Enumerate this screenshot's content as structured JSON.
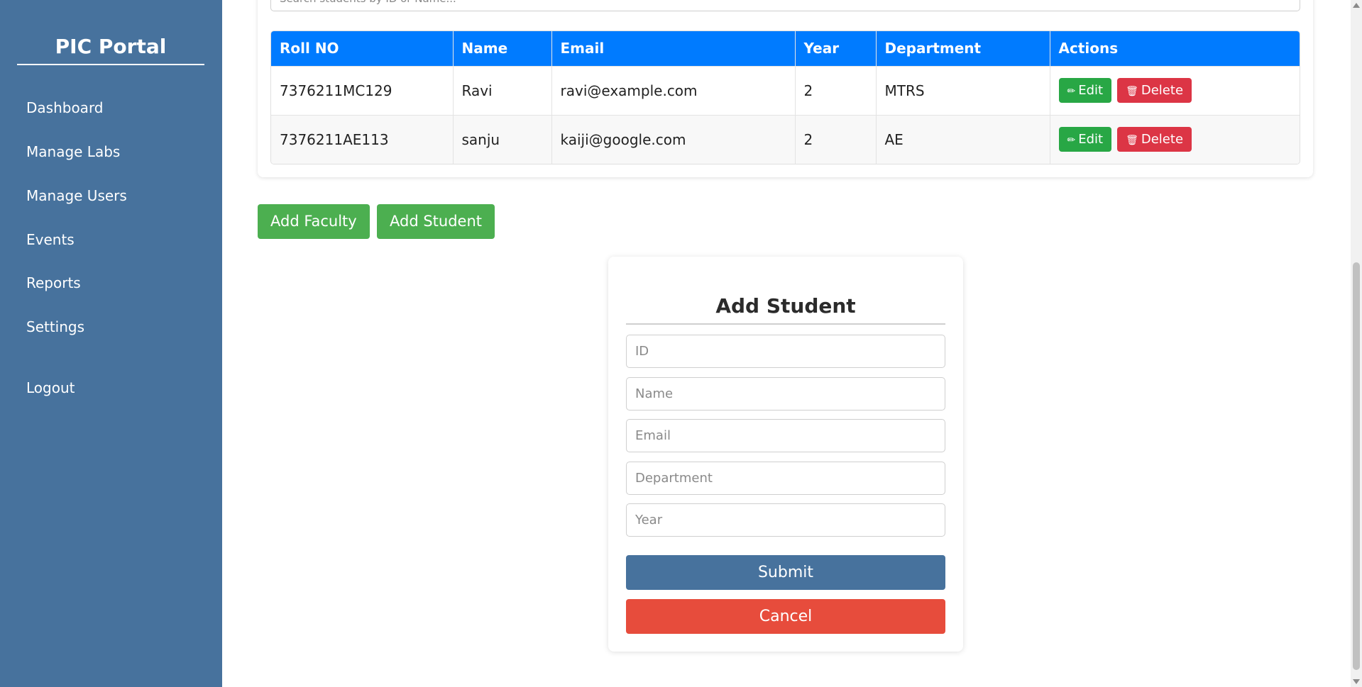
{
  "sidebar": {
    "brand": "PIC Portal",
    "items": [
      {
        "label": "Dashboard"
      },
      {
        "label": "Manage Labs"
      },
      {
        "label": "Manage Users"
      },
      {
        "label": "Events"
      },
      {
        "label": "Reports"
      },
      {
        "label": "Settings"
      },
      {
        "label": "Logout"
      }
    ]
  },
  "search": {
    "placeholder": "Search students by ID or Name..."
  },
  "table": {
    "headers": [
      "Roll NO",
      "Name",
      "Email",
      "Year",
      "Department",
      "Actions"
    ],
    "rows": [
      {
        "roll": "7376211MC129",
        "name": "Ravi",
        "email": "ravi@example.com",
        "year": "2",
        "department": "MTRS"
      },
      {
        "roll": "7376211AE113",
        "name": "sanju",
        "email": "kaiji@google.com",
        "year": "2",
        "department": "AE"
      }
    ],
    "edit_label": "Edit",
    "delete_label": "Delete",
    "edit_icon": "pencil-icon",
    "delete_icon": "trash-icon"
  },
  "actions": {
    "add_faculty": "Add Faculty",
    "add_student": "Add Student"
  },
  "form": {
    "title": "Add Student",
    "fields": [
      {
        "placeholder": "ID",
        "value": ""
      },
      {
        "placeholder": "Name",
        "value": ""
      },
      {
        "placeholder": "Email",
        "value": ""
      },
      {
        "placeholder": "Department",
        "value": ""
      },
      {
        "placeholder": "Year",
        "value": ""
      }
    ],
    "submit": "Submit",
    "cancel": "Cancel"
  },
  "colors": {
    "sidebar": "#47729d",
    "table_header": "#007bff",
    "edit": "#28a745",
    "delete": "#dc3545",
    "add": "#4caf50",
    "submit": "#47729d",
    "cancel": "#e74c3c"
  }
}
